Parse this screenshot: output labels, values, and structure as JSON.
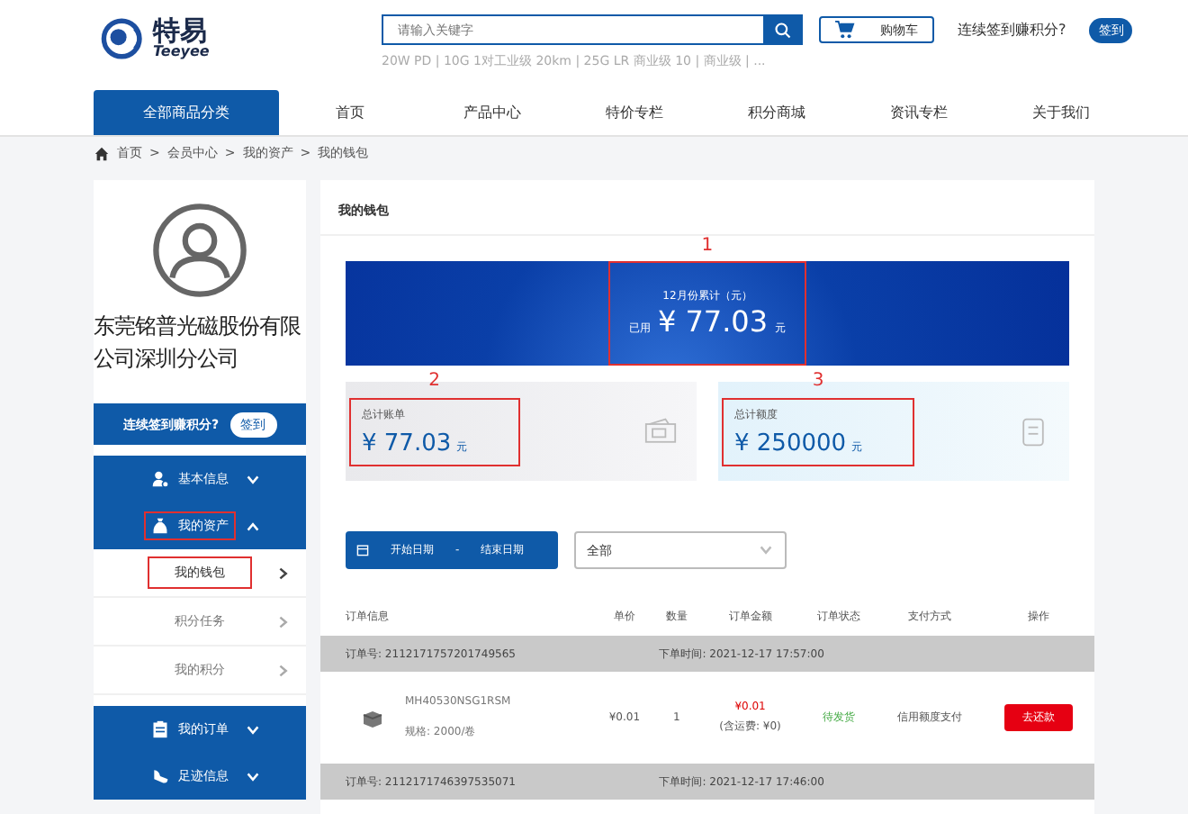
{
  "header": {
    "logo_text": "特易",
    "logo_subtext": "Teeyee",
    "search": {
      "placeholder": "请输入关键字"
    },
    "hot_words": "20W PD | 10G 1对工业级 20km | 25G LR 商业级 10 | 商业级 | ...",
    "cart_label": "购物车",
    "signin_prompt": "连续签到赚积分?",
    "signin_button": "签到"
  },
  "nav": {
    "category_button": "全部商品分类",
    "items": [
      {
        "label": "首页",
        "selected": false
      },
      {
        "label": "产品中心",
        "selected": false
      },
      {
        "label": "特价专栏",
        "selected": false
      },
      {
        "label": "积分商城",
        "selected": false
      },
      {
        "label": "资讯专栏",
        "selected": false
      },
      {
        "label": "关于我们",
        "selected": false
      }
    ]
  },
  "breadcrumb": [
    {
      "label": "首页"
    },
    {
      "separator": ">",
      "label": "会员中心"
    },
    {
      "separator": ">",
      "label": "我的资产"
    },
    {
      "separator": ">",
      "label": "我的钱包"
    }
  ],
  "sidebar": {
    "company": "东莞铭普光磁股份有限公司深圳分公司",
    "signin_prompt": "连续签到赚积分?",
    "signin_button": "签到",
    "menu": [
      {
        "kind": "person",
        "label": "基本信息",
        "expanded": false,
        "outlined": false
      },
      {
        "kind": "money",
        "label": "我的资产",
        "expanded": true,
        "outlined": true,
        "children": [
          {
            "label": "我的钱包",
            "selected": true,
            "outlined": true
          },
          {
            "label": "积分任务",
            "selected": false,
            "outlined": false
          },
          {
            "label": "我的积分",
            "selected": false,
            "outlined": false
          }
        ]
      },
      {
        "kind": "clipboard",
        "label": "我的订单",
        "expanded": false,
        "outlined": false
      },
      {
        "kind": "shoe",
        "label": "足迹信息",
        "expanded": false,
        "outlined": false
      }
    ]
  },
  "wallet": {
    "title": "我的钱包",
    "banner": {
      "callout": "1",
      "caption": "12月份累计（元）",
      "prefix": "已用",
      "amount": "¥ 77.03",
      "unit": "元"
    },
    "cards": [
      {
        "kind": "bill",
        "callout": "2",
        "label": "总计账单",
        "amount": "¥ 77.03",
        "unit": "元"
      },
      {
        "kind": "credit",
        "callout": "3",
        "label": "总计额度",
        "amount": "¥ 250000",
        "unit": "元"
      }
    ],
    "date_filter": {
      "start": "开始日期",
      "separator": "-",
      "end": "结束日期"
    },
    "status_select": {
      "value": "全部"
    },
    "table": {
      "columns": [
        "订单信息",
        "单价",
        "数量",
        "订单金额",
        "订单状态",
        "支付方式",
        "操作"
      ],
      "orders": [
        {
          "order_no": "订单号: 2112171757201749565",
          "time": "下单时间: 2021-12-17 17:57:00",
          "items": [
            {
              "name": "MH40530NSG1RSM",
              "spec": "规格: 2000/卷",
              "price": "¥0.01",
              "qty": "1",
              "total": "¥0.01",
              "shipping": "(含运费: ¥0)",
              "status": "待发货",
              "payment": "信用额度支付",
              "action": "去还款"
            }
          ]
        },
        {
          "order_no": "订单号: 2112171746397535071",
          "time": "下单时间: 2021-12-17 17:46:00"
        }
      ]
    }
  }
}
